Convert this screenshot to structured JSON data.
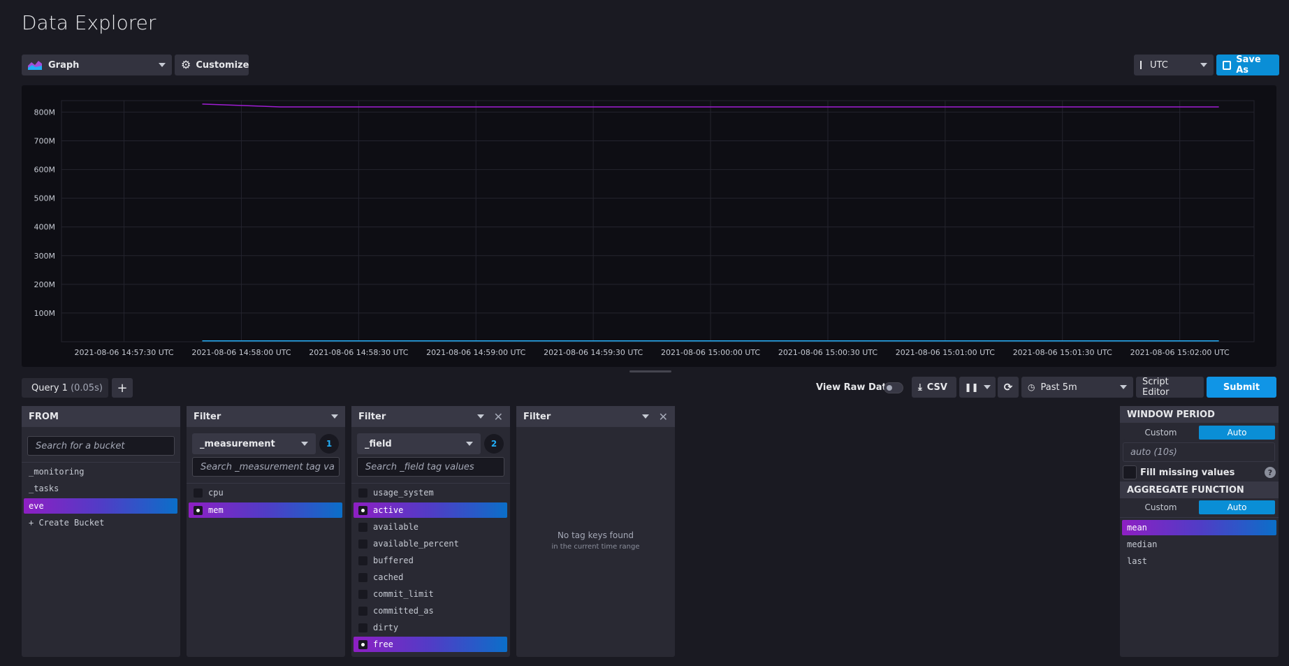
{
  "page": {
    "title": "Data Explorer"
  },
  "toolbar": {
    "view_type": "Graph",
    "customize": "Customize",
    "timezone": "UTC",
    "save_as": "Save As"
  },
  "chart_data": {
    "type": "line",
    "y_ticks": [
      "800M",
      "700M",
      "600M",
      "500M",
      "400M",
      "300M",
      "200M",
      "100M"
    ],
    "x_ticks": [
      "2021-08-06 14:57:30 UTC",
      "2021-08-06 14:58:00 UTC",
      "2021-08-06 14:58:30 UTC",
      "2021-08-06 14:59:00 UTC",
      "2021-08-06 14:59:30 UTC",
      "2021-08-06 15:00:00 UTC",
      "2021-08-06 15:00:30 UTC",
      "2021-08-06 15:01:00 UTC",
      "2021-08-06 15:01:30 UTC",
      "2021-08-06 15:02:00 UTC"
    ],
    "ylim": [
      0,
      840000000
    ],
    "x_range": [
      "2021-08-06 14:57:14 UTC",
      "2021-08-06 15:02:19 UTC"
    ],
    "series": [
      {
        "color": "#a01dd4",
        "x": [
          "2021-08-06 14:57:50 UTC",
          "2021-08-06 14:58:10 UTC",
          "2021-08-06 15:02:10 UTC"
        ],
        "y": [
          828000000,
          818000000,
          818000000
        ]
      },
      {
        "color": "#22adf6",
        "x": [
          "2021-08-06 14:57:50 UTC",
          "2021-08-06 15:02:10 UTC"
        ],
        "y": [
          3000000,
          3000000
        ]
      }
    ]
  },
  "query": {
    "tab_label": "Query 1",
    "tab_time": "(0.05s)",
    "add": "+",
    "view_raw": "View Raw Data",
    "csv": "CSV",
    "time_range": "Past 5m",
    "script_editor": "Script Editor",
    "submit": "Submit"
  },
  "from": {
    "header": "FROM",
    "search_placeholder": "Search for a bucket",
    "items": [
      "_monitoring",
      "_tasks",
      "eve",
      "+ Create Bucket"
    ]
  },
  "filter1": {
    "header": "Filter",
    "key": "_measurement",
    "count": "1",
    "search_placeholder": "Search _measurement tag va",
    "items": [
      "cpu",
      "mem"
    ]
  },
  "filter2": {
    "header": "Filter",
    "key": "_field",
    "count": "2",
    "search_placeholder": "Search _field tag values",
    "items": [
      "usage_system",
      "active",
      "available",
      "available_percent",
      "buffered",
      "cached",
      "commit_limit",
      "committed_as",
      "dirty",
      "free"
    ]
  },
  "filter3": {
    "header": "Filter",
    "empty_title": "No tag keys found",
    "empty_sub": "in the current time range"
  },
  "window": {
    "header": "WINDOW PERIOD",
    "custom": "Custom",
    "auto": "Auto",
    "value": "auto (10s)",
    "fill_missing": "Fill missing values",
    "help": "?",
    "agg_header": "AGGREGATE FUNCTION",
    "agg_custom": "Custom",
    "agg_auto": "Auto",
    "functions": [
      "mean",
      "median",
      "last"
    ]
  }
}
